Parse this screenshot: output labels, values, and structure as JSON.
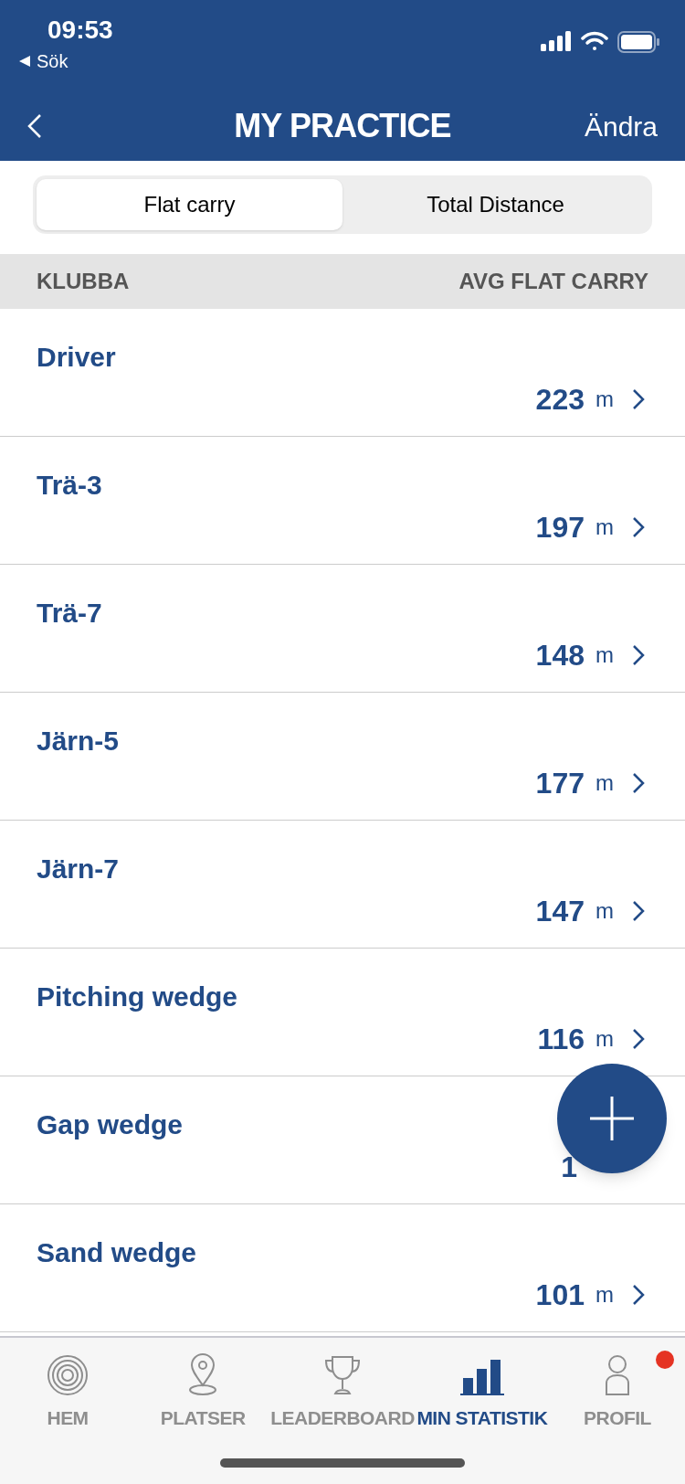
{
  "status_bar": {
    "time": "09:53",
    "back_label": "Sök"
  },
  "nav": {
    "title": "MY PRACTICE",
    "action": "Ändra"
  },
  "segments": [
    {
      "label": "Flat carry",
      "selected": true
    },
    {
      "label": "Total Distance",
      "selected": false
    }
  ],
  "table": {
    "columns": [
      "KLUBBA",
      "AVG FLAT CARRY"
    ],
    "rows": [
      {
        "club": "Driver",
        "value": "223",
        "unit": "m"
      },
      {
        "club": "Trä-3",
        "value": "197",
        "unit": "m"
      },
      {
        "club": "Trä-7",
        "value": "148",
        "unit": "m"
      },
      {
        "club": "Järn-5",
        "value": "177",
        "unit": "m"
      },
      {
        "club": "Järn-7",
        "value": "147",
        "unit": "m"
      },
      {
        "club": "Pitching wedge",
        "value": "116",
        "unit": "m"
      },
      {
        "club": "Gap wedge",
        "value": "1"
      },
      {
        "club": "Sand wedge",
        "value": "101",
        "unit": "m"
      }
    ]
  },
  "tab_bar": [
    {
      "label": "HEM",
      "kind": "home",
      "selected": false,
      "badge": false
    },
    {
      "label": "PLATSER",
      "kind": "places",
      "selected": false,
      "badge": false
    },
    {
      "label": "LEADERBOARD",
      "kind": "leaderboard",
      "selected": false,
      "badge": false
    },
    {
      "label": "MIN STATISTIK",
      "kind": "stats",
      "selected": true,
      "badge": false
    },
    {
      "label": "PROFIL",
      "kind": "profile",
      "selected": false,
      "badge": true
    }
  ]
}
